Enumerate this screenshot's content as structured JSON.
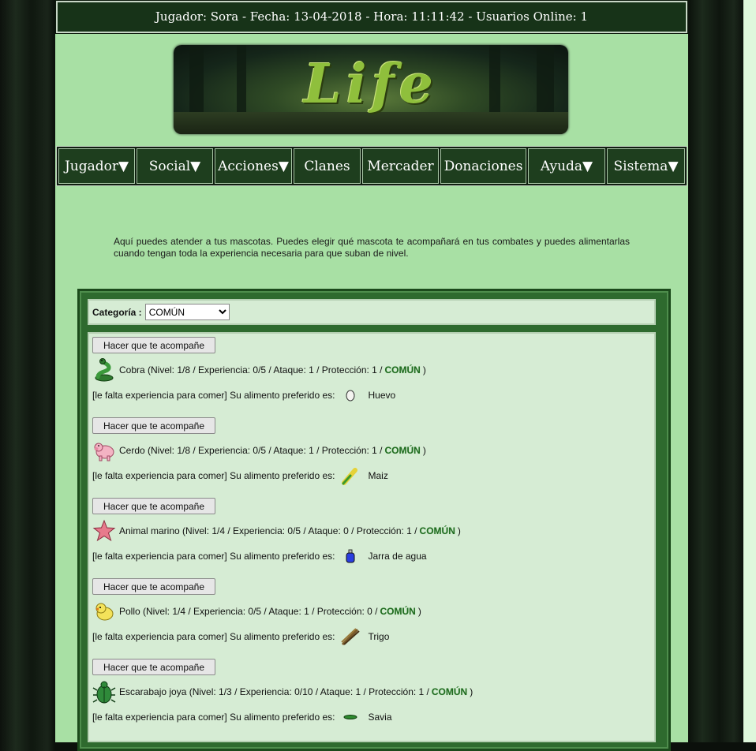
{
  "status_bar": {
    "text": "Jugador: Sora - Fecha: 13-04-2018 - Hora: 11:11:42 - Usuarios Online: 1"
  },
  "banner": {
    "logo_text": "Life"
  },
  "nav": {
    "items": [
      {
        "label": "Jugador▼"
      },
      {
        "label": "Social▼"
      },
      {
        "label": "Acciones▼"
      },
      {
        "label": "Clanes"
      },
      {
        "label": "Mercader"
      },
      {
        "label": "Donaciones"
      },
      {
        "label": "Ayuda▼"
      },
      {
        "label": "Sistema▼"
      }
    ]
  },
  "intro": {
    "text": "Aquí puedes atender a tus mascotas. Puedes elegir qué mascota te acompañará en tus combates y puedes alimentarlas cuando tengan toda la experiencia necesaria para que suban de nivel."
  },
  "category": {
    "label": "Categoría :",
    "selected": "COMÚN"
  },
  "pets": [
    {
      "button": "Hacer que te acompañe",
      "icon": "snake-icon",
      "info": "Cobra (Nivel: 1/8 / Experiencia: 0/5 / Ataque: 1 / Protección: 1 /",
      "rarity": "COMÚN",
      "close": ")",
      "food_text": "[le falta experiencia para comer] Su alimento preferido es:",
      "food_icon": "egg-icon",
      "food_name": "Huevo"
    },
    {
      "button": "Hacer que te acompañe",
      "icon": "pig-icon",
      "info": "Cerdo (Nivel: 1/8 / Experiencia: 0/5 / Ataque: 1 / Protección: 1 /",
      "rarity": "COMÚN",
      "close": ")",
      "food_text": "[le falta experiencia para comer] Su alimento preferido es:",
      "food_icon": "corn-icon",
      "food_name": "Maiz"
    },
    {
      "button": "Hacer que te acompañe",
      "icon": "starfish-icon",
      "info": "Animal marino (Nivel: 1/4 / Experiencia: 0/5 / Ataque: 0 / Protección: 1 /",
      "rarity": "COMÚN",
      "close": ")",
      "food_text": "[le falta experiencia para comer] Su alimento preferido es:",
      "food_icon": "water-jar-icon",
      "food_name": "Jarra de agua"
    },
    {
      "button": "Hacer que te acompañe",
      "icon": "chick-icon",
      "info": "Pollo (Nivel: 1/4 / Experiencia: 0/5 / Ataque: 1 / Protección: 0 /",
      "rarity": "COMÚN",
      "close": ")",
      "food_text": "[le falta experiencia para comer] Su alimento preferido es:",
      "food_icon": "wheat-icon",
      "food_name": "Trigo"
    },
    {
      "button": "Hacer que te acompañe",
      "icon": "beetle-icon",
      "info": "Escarabajo joya (Nivel: 1/3 / Experiencia: 0/10 / Ataque: 1 / Protección: 1 /",
      "rarity": "COMÚN",
      "close": ")",
      "food_text": "[le falta experiencia para comer] Su alimento preferido es:",
      "food_icon": "sap-icon",
      "food_name": "Savia"
    }
  ]
}
